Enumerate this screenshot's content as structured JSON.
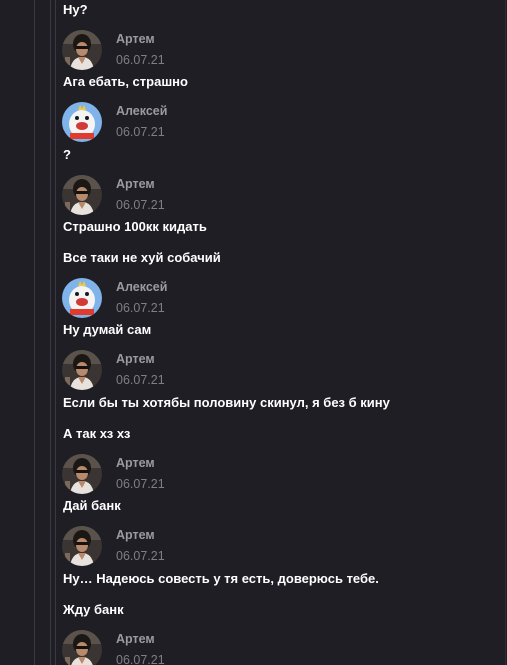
{
  "thread": {
    "top_message": "Ну?",
    "groups": [
      {
        "author": "Артем",
        "date": "06.07.21",
        "avatar_icon": "artem-avatar-icon",
        "messages": [
          "Ага ебать, страшно"
        ]
      },
      {
        "author": "Алексей",
        "date": "06.07.21",
        "avatar_icon": "aleksey-avatar-icon",
        "messages": [
          "?"
        ]
      },
      {
        "author": "Артем",
        "date": "06.07.21",
        "avatar_icon": "artem-avatar-icon",
        "messages": [
          "Страшно 100кк кидать",
          "Все таки не хуй собачий"
        ]
      },
      {
        "author": "Алексей",
        "date": "06.07.21",
        "avatar_icon": "aleksey-avatar-icon",
        "messages": [
          "Ну думай сам"
        ]
      },
      {
        "author": "Артем",
        "date": "06.07.21",
        "avatar_icon": "artem-avatar-icon",
        "messages": [
          "Если бы ты хотябы половину скинул, я без б кину",
          "А так хз хз"
        ]
      },
      {
        "author": "Артем",
        "date": "06.07.21",
        "avatar_icon": "artem-avatar-icon",
        "messages": [
          "Дай банк"
        ]
      },
      {
        "author": "Артем",
        "date": "06.07.21",
        "avatar_icon": "artem-avatar-icon",
        "messages": [
          "Ну… Надеюсь совесть у тя есть, доверюсь тебе.",
          "Жду банк"
        ]
      },
      {
        "author": "Артем",
        "date": "06.07.21",
        "avatar_icon": "artem-avatar-icon",
        "messages": []
      }
    ]
  },
  "colors": {
    "background": "#1f1e24",
    "message_text": "#ffffff",
    "author_text": "#9b9aa3",
    "date_text": "#7f7e87",
    "rail": "#3b3a42"
  }
}
